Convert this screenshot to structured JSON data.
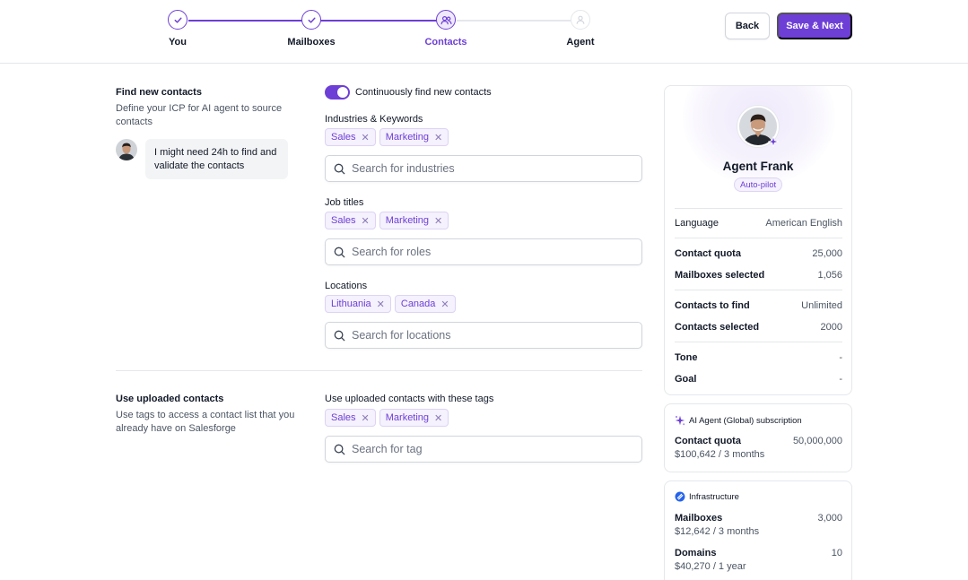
{
  "stepper": {
    "steps": [
      {
        "label": "You",
        "state": "done"
      },
      {
        "label": "Mailboxes",
        "state": "done"
      },
      {
        "label": "Contacts",
        "state": "current"
      },
      {
        "label": "Agent",
        "state": "todo"
      }
    ]
  },
  "header": {
    "back_label": "Back",
    "next_label": "Save & Next"
  },
  "find_section": {
    "title": "Find new contacts",
    "description": "Define your ICP for AI agent to source contacts",
    "bubble_text": "I might need 24h to find and validate the contacts",
    "toggle_label": "Continuously find new contacts",
    "toggle_on": true,
    "industries": {
      "label": "Industries & Keywords",
      "tags": [
        "Sales",
        "Marketing"
      ],
      "placeholder": "Search for industries"
    },
    "job_titles": {
      "label": "Job titles",
      "tags": [
        "Sales",
        "Marketing"
      ],
      "placeholder": "Search for roles"
    },
    "locations": {
      "label": "Locations",
      "tags": [
        "Lithuania",
        "Canada"
      ],
      "placeholder": "Search for locations"
    }
  },
  "upload_section": {
    "title": "Use uploaded contacts",
    "description": "Use tags to access a contact list that you already have on Salesforge",
    "tags_label": "Use uploaded contacts with these tags",
    "tags": [
      "Sales",
      "Marketing"
    ],
    "placeholder": "Search for tag"
  },
  "agent_card": {
    "name": "Agent Frank",
    "badge": "Auto-pilot",
    "language": {
      "label": "Language",
      "value": "American English"
    },
    "contact_quota": {
      "label": "Contact quota",
      "value": "25,000"
    },
    "mailboxes_selected": {
      "label": "Mailboxes selected",
      "value": "1,056"
    },
    "contacts_to_find": {
      "label": "Contacts to find",
      "value": "Unlimited"
    },
    "contacts_selected": {
      "label": "Contacts selected",
      "value": "2000"
    },
    "tone": {
      "label": "Tone",
      "value": "-"
    },
    "goal": {
      "label": "Goal",
      "value": "-"
    }
  },
  "subscription_card": {
    "title": "AI Agent (Global) subscription",
    "row_label": "Contact quota",
    "row_value": "50,000,000",
    "row_price": "$100,642 / 3 months"
  },
  "infrastructure_card": {
    "title": "Infrastructure",
    "mailboxes": {
      "label": "Mailboxes",
      "value": "3,000",
      "price": "$12,642 / 3 months"
    },
    "domains": {
      "label": "Domains",
      "value": "10",
      "price": "$40,270 / 1 year"
    }
  },
  "colors": {
    "accent": "#6d3fd6",
    "tag_bg": "#f5f1fd",
    "border": "#e5e7eb"
  }
}
